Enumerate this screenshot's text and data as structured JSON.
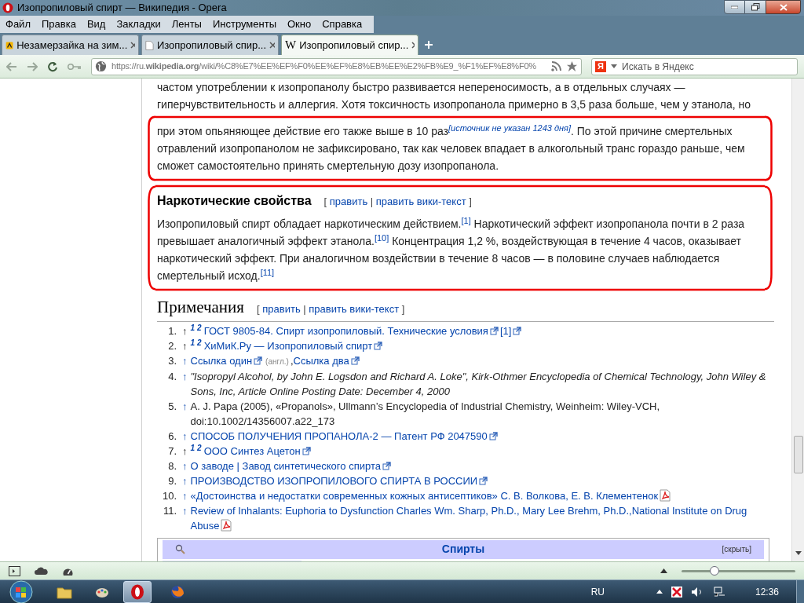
{
  "window": {
    "title": "Изопропиловый спирт — Википедия - Opera"
  },
  "menu": [
    "Файл",
    "Правка",
    "Вид",
    "Закладки",
    "Ленты",
    "Инструменты",
    "Окно",
    "Справка"
  ],
  "tabs": [
    {
      "label": "Незамерзайка на зим...",
      "selected": false,
      "kind": "yandex"
    },
    {
      "label": "Изопропиловый спир...",
      "selected": false,
      "kind": "page"
    },
    {
      "label": "Изопропиловый спир...",
      "selected": true,
      "kind": "letter",
      "favicon_text": "W"
    }
  ],
  "address": {
    "url": "https://ru.**wikipedia.org**/wiki/%C8%E7%EE%EF%F0%EE%EF%E8%EB%EE%E2%FB%E9_%F1%EF%E8%F0%"
  },
  "search": {
    "logo": "Я",
    "placeholder": "Искать в Яндекс"
  },
  "article": {
    "paragraph_1_lead": [
      {
        "kind": "text",
        "text": "частом употреблении к изопропанолу быстро развивается непереносимость, а в отдельных случаях — гиперчувствительность и аллергия. Хотя токсичность изопропанола примерно в 3,5 раза больше, чем у этанола, но"
      }
    ],
    "paragraph_1": [
      {
        "kind": "text",
        "text": "при этом опьяняющее действие его также выше в 10 раз"
      },
      {
        "kind": "flag",
        "text": "[источник не указан 1243 дня]"
      },
      {
        "kind": "text",
        "text": ". По этой причине смертельных отравлений изопропанолом не зафиксировано, так как человек впадает в алкогольный транс гораздо раньше, чем сможет самостоятельно принять смертельную дозу изопропанола."
      }
    ],
    "section": {
      "heading": "Наркотические свойства",
      "edit": {
        "open": "[",
        "links": [
          "править",
          "править вики-текст"
        ],
        "separator": "|",
        "close": "]"
      }
    },
    "paragraph_2": [
      {
        "kind": "text",
        "text": "Изопропиловый спирт обладает наркотическим действием."
      },
      {
        "kind": "ref",
        "text": "[1]"
      },
      {
        "kind": "text",
        "text": " Наркотический эффект изопропанола почти в 2 раза превышает аналогичный эффект этанола."
      },
      {
        "kind": "ref",
        "text": "[10]"
      },
      {
        "kind": "text",
        "text": " Концентрация 1,2 %, воздействующая в течение 4 часов, оказывает наркотический эффект. При аналогичном воздействии в течение 8 часов — в половине случаев наблюдается смертельный исход."
      },
      {
        "kind": "ref",
        "text": "[11]"
      }
    ],
    "notes_heading": "Примечания",
    "notes_edit": {
      "open": "[",
      "links": [
        "править",
        "править вики-текст"
      ],
      "separator": "|",
      "close": "]"
    },
    "notes": [
      {
        "number": "1.",
        "arrow": "↑",
        "arrow_link": false,
        "backrefs": [
          "1",
          "2"
        ],
        "parts": [
          {
            "kind": "link",
            "text": "ГОСТ 9805-84. Спирт изопропиловый. Технические условия"
          },
          {
            "kind": "ext"
          },
          {
            "kind": "link",
            "text": "[1]"
          },
          {
            "kind": "ext"
          }
        ]
      },
      {
        "number": "2.",
        "arrow": "↑",
        "arrow_link": false,
        "backrefs": [
          "1",
          "2"
        ],
        "parts": [
          {
            "kind": "link",
            "text": "ХиМиК.Ру — Изопропиловый спирт"
          },
          {
            "kind": "ext"
          }
        ]
      },
      {
        "number": "3.",
        "arrow": "↑",
        "arrow_link": true,
        "parts": [
          {
            "kind": "link",
            "text": "Ссылка один"
          },
          {
            "kind": "ext"
          },
          {
            "kind": "note",
            "text": "(англ.)"
          },
          {
            "kind": "text",
            "text": ","
          },
          {
            "kind": "link",
            "text": "Ссылка два"
          },
          {
            "kind": "ext"
          }
        ]
      },
      {
        "number": "4.",
        "arrow": "↑",
        "arrow_link": true,
        "parts": [
          {
            "kind": "italic",
            "text": "\"Isopropyl Alcohol, by John E. Logsdon and Richard A. Loke\", Kirk-Othmer Encyclopedia of Chemical Technology, John Wiley & Sons, Inc, Article Online Posting Date: December 4, 2000"
          }
        ]
      },
      {
        "number": "5.",
        "arrow": "↑",
        "arrow_link": true,
        "parts": [
          {
            "kind": "text",
            "text": "A. J. Papa (2005), «Propanols», Ullmann’s Encyclopedia of Industrial Chemistry, Weinheim: Wiley-VCH, doi:10.1002/14356007.a22_173"
          }
        ]
      },
      {
        "number": "6.",
        "arrow": "↑",
        "arrow_link": true,
        "parts": [
          {
            "kind": "link",
            "text": "СПОСОБ ПОЛУЧЕНИЯ ПРОПАНОЛА-2 — Патент РФ 2047590"
          },
          {
            "kind": "ext"
          }
        ]
      },
      {
        "number": "7.",
        "arrow": "↑",
        "arrow_link": false,
        "backrefs": [
          "1",
          "2"
        ],
        "parts": [
          {
            "kind": "link",
            "text": "ООО Синтез Ацетон"
          },
          {
            "kind": "ext"
          }
        ]
      },
      {
        "number": "8.",
        "arrow": "↑",
        "arrow_link": true,
        "parts": [
          {
            "kind": "link",
            "text": "О заводе | Завод синтетического спирта"
          },
          {
            "kind": "ext"
          }
        ]
      },
      {
        "number": "9.",
        "arrow": "↑",
        "arrow_link": true,
        "parts": [
          {
            "kind": "link",
            "text": "ПРОИЗВОДСТВО ИЗОПРОПИЛОВОГО СПИРТА В РОССИИ"
          },
          {
            "kind": "ext"
          }
        ]
      },
      {
        "number": "10.",
        "arrow": "↑",
        "arrow_link": true,
        "parts": [
          {
            "kind": "link",
            "text": "«Достоинства и недостатки современных кожных антисептиков» С. В. Волкова, Е. В. Клементенок"
          },
          {
            "kind": "pdf"
          }
        ]
      },
      {
        "number": "11.",
        "arrow": "↑",
        "arrow_link": true,
        "parts": [
          {
            "kind": "link",
            "text": "Review of Inhalants: Euphoria to Dysfunction Charles Wm. Sharp, Ph.D., Mary Lee Brehm, Ph.D.,National Institute on Drug Abuse"
          },
          {
            "kind": "pdf"
          }
        ]
      }
    ],
    "navbox": {
      "title": "Спирты",
      "toggle": "[скрыть]"
    }
  },
  "status_bar": {
    "zoom": {
      "level": 0.29
    }
  },
  "taskbar": {
    "language": "RU",
    "time": "12:36"
  }
}
